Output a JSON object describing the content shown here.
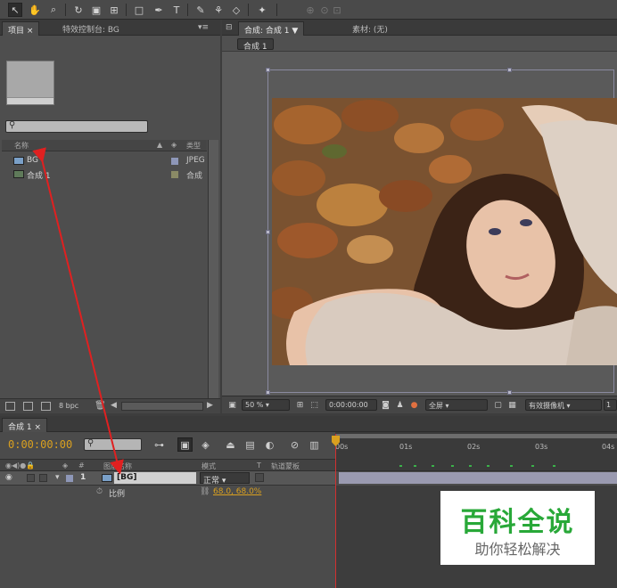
{
  "project_panel": {
    "tabs": [
      "项目 ×",
      "特效控制台: BG"
    ],
    "header": {
      "name": "名称",
      "type": "类型"
    },
    "items": [
      {
        "name": "BG",
        "type": "JPEG",
        "swatch": "#8e97b8"
      },
      {
        "name": "合成 1",
        "type": "合成",
        "swatch": "#8a8a66"
      }
    ],
    "bit_depth": "8 bpc"
  },
  "comp_panel": {
    "tabs": [
      "合成: 合成 1 ▼",
      "素材: (无)"
    ],
    "comp_chip": "合成 1",
    "zoom": "50 %",
    "timecode": "0:00:00:00",
    "resolution": "全屏",
    "camera": "有效摄像机"
  },
  "timeline": {
    "tab": "合成 1 ×",
    "timecode": "0:00:00:00",
    "ruler": [
      "00s",
      "01s",
      "02s",
      "03s",
      "04s"
    ],
    "columns": {
      "source": "图层名称",
      "mode": "模式",
      "t": "T",
      "trkmat": "轨道蒙板"
    },
    "layer": {
      "index": "1",
      "name": "[BG]",
      "mode": "正常"
    },
    "property": {
      "name": "比例",
      "value": "68.0, 68.0%"
    }
  },
  "watermark": {
    "title": "百科全说",
    "subtitle": "助你轻松解决"
  },
  "colors": {
    "accent": "#d9a020",
    "arrow": "#e02020",
    "watermark_green": "#28a838"
  }
}
